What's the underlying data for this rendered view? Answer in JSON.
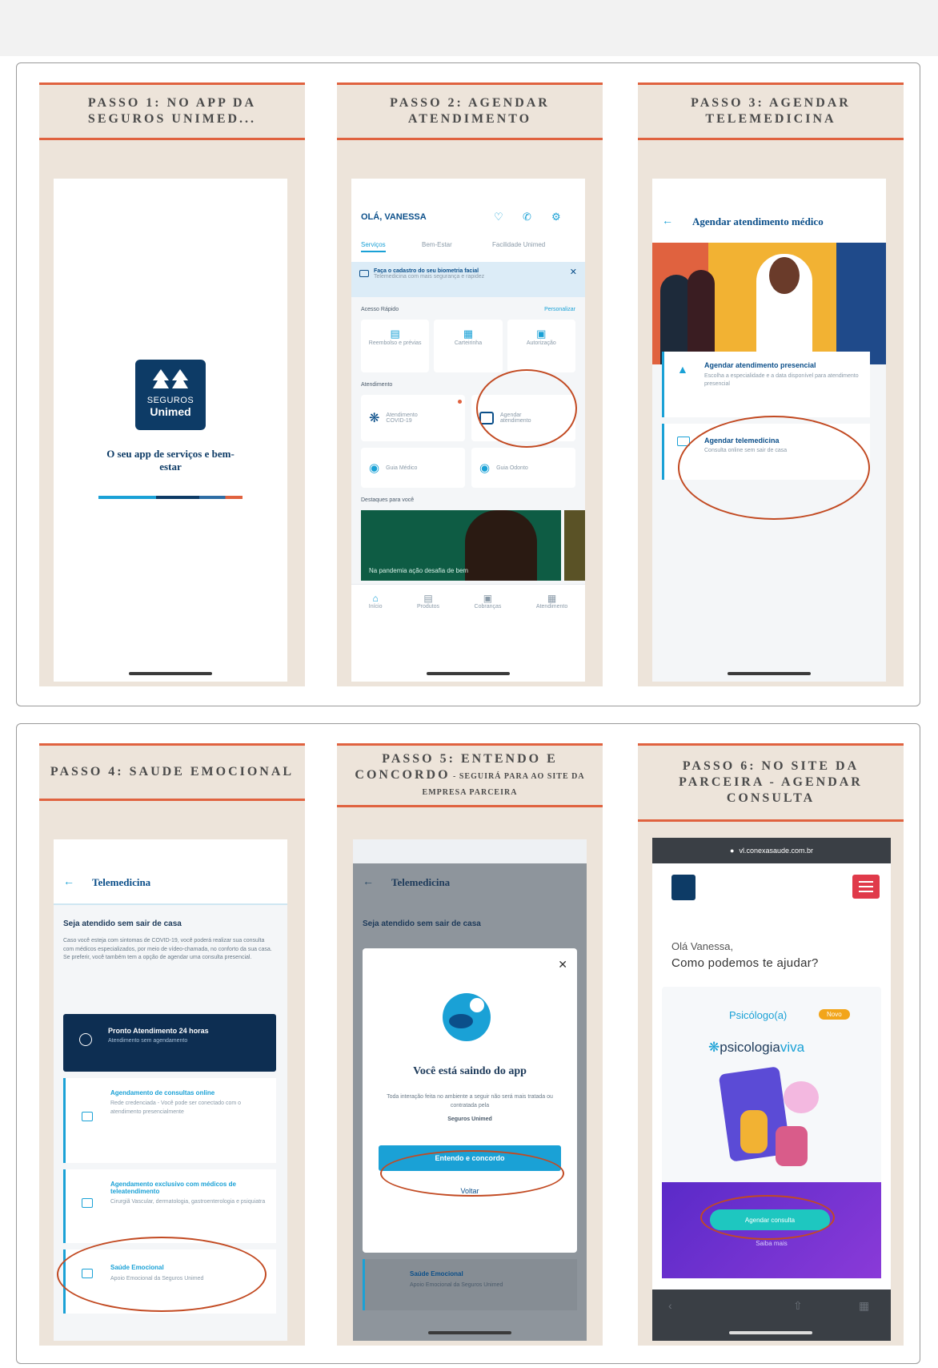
{
  "steps": [
    {
      "caption": "PASSO 1: NO APP DA SEGUROS UNIMED..."
    },
    {
      "caption": "PASSO 2: AGENDAR ATENDIMENTO"
    },
    {
      "caption": "PASSO 3: AGENDAR TELEMEDICINA"
    },
    {
      "caption": "PASSO 4: SAUDE EMOCIONAL"
    },
    {
      "caption": "PASSO 5: ENTENDO E CONCORDO",
      "sub": " - SEGUIRÁ PARA AO SITE DA EMPRESA PARCEIRA"
    },
    {
      "caption": "PASSO 6: NO SITE DA PARCEIRA - AGENDAR CONSULTA"
    }
  ],
  "splash": {
    "logo_line1": "SEGUROS",
    "logo_line2": "Unimed",
    "tagline": "O seu app de serviços e bem-estar"
  },
  "home": {
    "greeting": "OLÁ, VANESSA",
    "tabs": [
      "Serviços",
      "Bem-Estar",
      "Facilidade Unimed"
    ],
    "banner_title": "Faça o cadastro do seu biometria facial",
    "banner_text": "Telemedicina com mais segurança e rapidez",
    "quick_label": "Acesso Rápido",
    "customize": "Personalizar",
    "quick": [
      "Reembolso e prévias",
      "Carteirinha",
      "Autorização"
    ],
    "attend_label": "Atendimento",
    "attend": [
      "Atendimento COVID-19",
      "Agendar atendimento",
      "Guia Médico",
      "Guia Odonto"
    ],
    "for_you": "Destaques para você",
    "promo": "Na pandemia ação desafia de bem",
    "nav": [
      "Início",
      "Produtos",
      "Cobranças",
      "Atendimento"
    ]
  },
  "schedule": {
    "title": "Agendar atendimento médico",
    "opt1_title": "Agendar atendimento presencial",
    "opt1_text": "Escolha a especialidade e a data disponível para atendimento presencial",
    "opt2_title": "Agendar telemedicina",
    "opt2_text": "Consulta online sem sair de casa"
  },
  "tele": {
    "title": "Telemedicina",
    "subtitle": "Seja atendido sem sair de casa",
    "body": "Caso você esteja com sintomas de COVID-19, você poderá realizar sua consulta com médicos especializados, por meio de vídeo-chamada, no conforto da sua casa. Se preferir, você também tem a opção de agendar uma consulta presencial.",
    "dark_title": "Pronto Atendimento 24 horas",
    "dark_text": "Atendimento sem agendamento",
    "item1_title": "Agendamento de consultas online",
    "item1_text": "Rede credenciada - Você pode ser conectado com o atendimento presencialmente",
    "item2_title": "Agendamento exclusivo com médicos de teleatendimento",
    "item2_text": "Cirurgiã Vascular, dermatologia, gastroenterologia e psiquiatra",
    "item3_title": "Saúde Emocional",
    "item3_text": "Apoio Emocional da Seguros Unimed"
  },
  "modal": {
    "title": "Você está saindo do app",
    "text": "Toda interação feita no ambiente a seguir não será mais tratada ou contratada pela",
    "brand": "Seguros Unimed",
    "agree": "Entendo e concordo",
    "back": "Voltar"
  },
  "site": {
    "url": "vl.conexasaude.com.br",
    "hello": "Olá Vanessa,",
    "question": "Como podemos te ajudar?",
    "service": "Psicólogo(a)",
    "badge": "Novo",
    "brand_a": "psicologia",
    "brand_b": "viva",
    "cta": "Agendar consulta",
    "more": "Saiba mais"
  },
  "colors": {
    "accent_red": "#e0623f",
    "unimed_blue": "#0b4f8a",
    "card_beige": "#ede4da",
    "cta_blue": "#1aa1d6"
  }
}
